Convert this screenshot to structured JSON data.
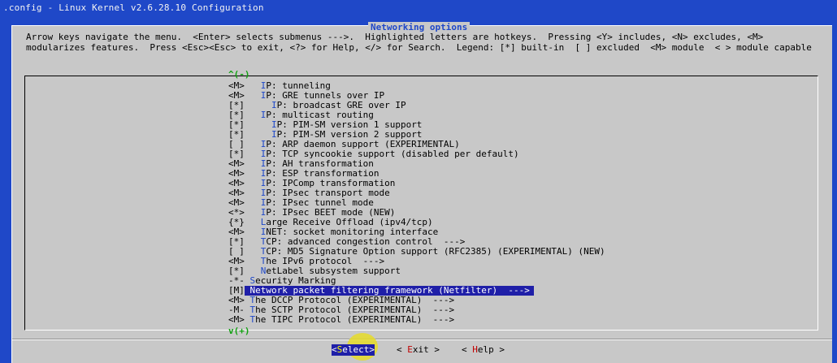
{
  "window": {
    "title": ".config - Linux Kernel v2.6.28.10 Configuration"
  },
  "dialog": {
    "title": "Networking options",
    "help_line1": "Arrow keys navigate the menu.  <Enter> selects submenus --->.  Highlighted letters are hotkeys.  Pressing <Y> includes, <N> excludes, <M>",
    "help_line2": "modularizes features.  Press <Esc><Esc> to exit, <?> for Help, </> for Search.  Legend: [*] built-in  [ ] excluded  <M> module  < > module capable",
    "scroll_up": "^(-)",
    "scroll_down": "v(+)"
  },
  "menu": {
    "items": [
      {
        "mark": "<M>",
        "indent": "   ",
        "hotkey": "I",
        "rest": "P: tunneling"
      },
      {
        "mark": "<M>",
        "indent": "   ",
        "hotkey": "I",
        "rest": "P: GRE tunnels over IP"
      },
      {
        "mark": "[*]",
        "indent": "     ",
        "hotkey": "I",
        "rest": "P: broadcast GRE over IP"
      },
      {
        "mark": "[*]",
        "indent": "   ",
        "hotkey": "I",
        "rest": "P: multicast routing"
      },
      {
        "mark": "[*]",
        "indent": "     ",
        "hotkey": "I",
        "rest": "P: PIM-SM version 1 support"
      },
      {
        "mark": "[*]",
        "indent": "     ",
        "hotkey": "I",
        "rest": "P: PIM-SM version 2 support"
      },
      {
        "mark": "[ ]",
        "indent": "   ",
        "hotkey": "I",
        "rest": "P: ARP daemon support (EXPERIMENTAL)"
      },
      {
        "mark": "[*]",
        "indent": "   ",
        "hotkey": "I",
        "rest": "P: TCP syncookie support (disabled per default)"
      },
      {
        "mark": "<M>",
        "indent": "   ",
        "hotkey": "I",
        "rest": "P: AH transformation"
      },
      {
        "mark": "<M>",
        "indent": "   ",
        "hotkey": "I",
        "rest": "P: ESP transformation"
      },
      {
        "mark": "<M>",
        "indent": "   ",
        "hotkey": "I",
        "rest": "P: IPComp transformation"
      },
      {
        "mark": "<M>",
        "indent": "   ",
        "hotkey": "I",
        "rest": "P: IPsec transport mode"
      },
      {
        "mark": "<M>",
        "indent": "   ",
        "hotkey": "I",
        "rest": "P: IPsec tunnel mode"
      },
      {
        "mark": "<*>",
        "indent": "   ",
        "hotkey": "I",
        "rest": "P: IPsec BEET mode (NEW)"
      },
      {
        "mark": "{*}",
        "indent": "   ",
        "hotkey": "L",
        "rest": "arge Receive Offload (ipv4/tcp)"
      },
      {
        "mark": "<M>",
        "indent": "   ",
        "hotkey": "I",
        "rest": "NET: socket monitoring interface"
      },
      {
        "mark": "[*]",
        "indent": "   ",
        "hotkey": "T",
        "rest": "CP: advanced congestion control  --->"
      },
      {
        "mark": "[ ]",
        "indent": "   ",
        "hotkey": "T",
        "rest": "CP: MD5 Signature Option support (RFC2385) (EXPERIMENTAL) (NEW)"
      },
      {
        "mark": "<M>",
        "indent": "   ",
        "hotkey": "T",
        "rest": "he IPv6 protocol  --->"
      },
      {
        "mark": "[*]",
        "indent": "   ",
        "hotkey": "N",
        "rest": "etLabel subsystem support"
      },
      {
        "mark": "-*-",
        "indent": " ",
        "hotkey": "S",
        "rest": "ecurity Marking"
      },
      {
        "mark": "[M]",
        "indent": " ",
        "hotkey": "N",
        "rest": "etwork packet filtering framework (Netfilter)  --->",
        "selected": true
      },
      {
        "mark": "<M>",
        "indent": " ",
        "hotkey": "T",
        "rest": "he DCCP Protocol (EXPERIMENTAL)  --->"
      },
      {
        "mark": "-M-",
        "indent": " ",
        "hotkey": "T",
        "rest": "he SCTP Protocol (EXPERIMENTAL)  --->"
      },
      {
        "mark": "<M>",
        "indent": " ",
        "hotkey": "T",
        "rest": "he TIPC Protocol (EXPERIMENTAL)  --->"
      }
    ]
  },
  "buttons": {
    "select": {
      "pre": "<",
      "hotkey": "S",
      "post": "elect>"
    },
    "exit": {
      "pre": "< ",
      "hotkey": "E",
      "post": "xit >"
    },
    "help": {
      "pre": "< ",
      "hotkey": "H",
      "post": "elp >"
    }
  },
  "colors": {
    "background": "#1f48c8",
    "dialog": "#c8c8c8",
    "hotkey": "#1f48c8",
    "selection": "#1f1fa8",
    "scroll_arrow": "#10a010"
  }
}
